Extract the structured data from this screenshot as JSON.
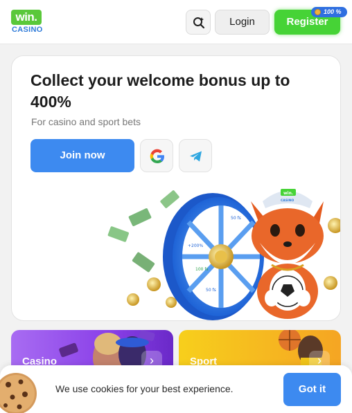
{
  "header": {
    "logo_top": "win.",
    "logo_bottom": "CASINO",
    "search_icon": "search-icon",
    "login_label": "Login",
    "register_label": "Register",
    "register_badge": "100 %"
  },
  "promo": {
    "title": "Collect your welcome bonus up to 400%",
    "subtitle": "For casino and sport bets",
    "join_label": "Join now",
    "social_icons": [
      "google-icon",
      "telegram-icon"
    ],
    "hero_texts": [
      "win.",
      "CASINO",
      "50 fs",
      "200%",
      "+200%",
      "100 fs",
      "50 fs",
      "50 fs"
    ]
  },
  "categories": [
    {
      "label": "Casino",
      "chevron": "›"
    },
    {
      "label": "Sport",
      "chevron": "›"
    }
  ],
  "cookie": {
    "text": "We use cookies for your best experience.",
    "button_label": "Got it"
  },
  "colors": {
    "brand_green": "#46d336",
    "primary_blue": "#3d8af0",
    "casino_purple": "#8a40e8",
    "sport_yellow": "#f5b820"
  }
}
